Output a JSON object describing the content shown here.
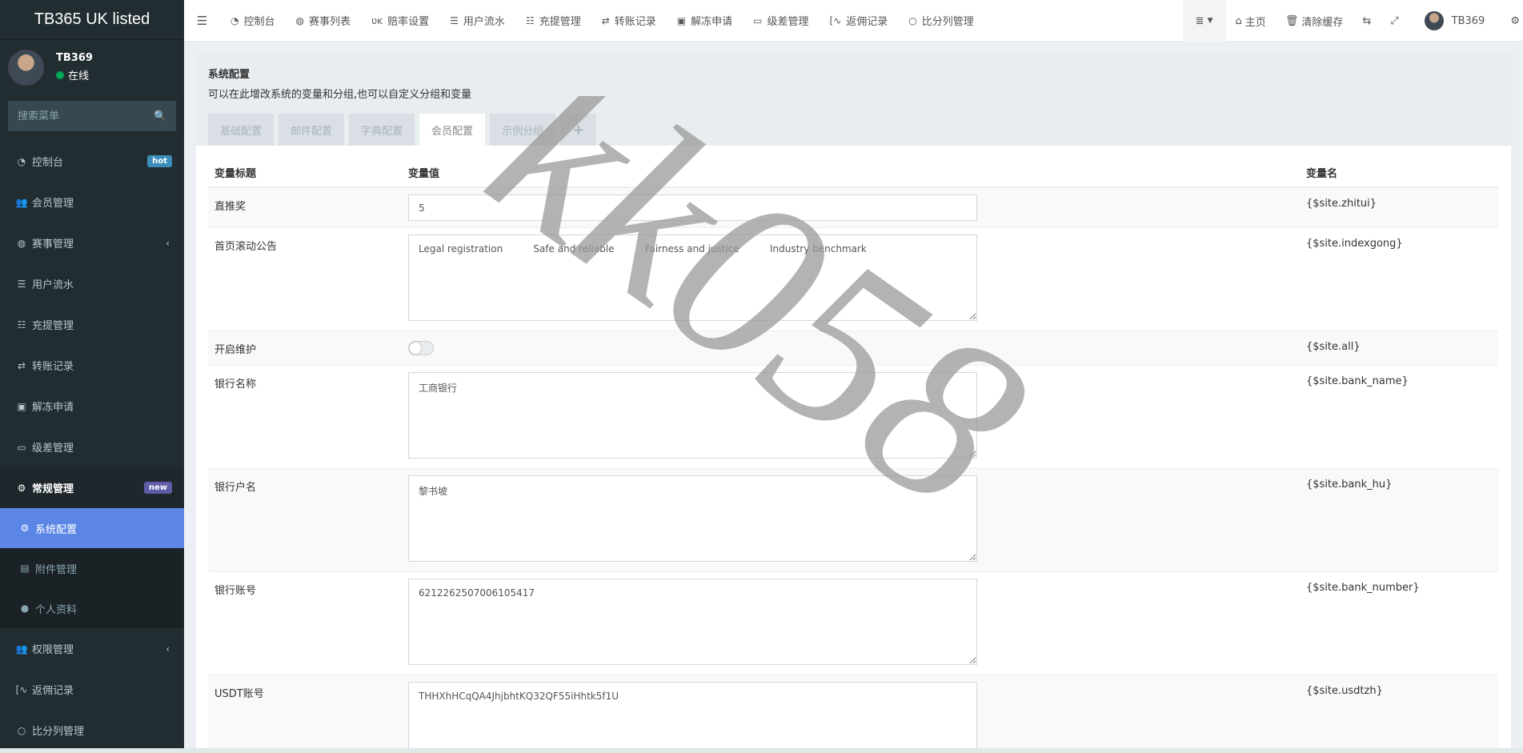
{
  "brand": "TB365 UK listed",
  "user": {
    "name": "TB369",
    "status": "在线"
  },
  "search": {
    "placeholder": "搜索菜单"
  },
  "sidebar": {
    "items": [
      {
        "label": "控制台",
        "badge": "hot",
        "icon": "dashboard-icon"
      },
      {
        "label": "会员管理",
        "icon": "users-icon"
      },
      {
        "label": "赛事管理",
        "icon": "globe-icon"
      },
      {
        "label": "用户流水",
        "icon": "list-icon"
      },
      {
        "label": "充提管理",
        "icon": "list-alt-icon"
      },
      {
        "label": "转账记录",
        "icon": "transfer-icon"
      },
      {
        "label": "解冻申请",
        "icon": "image-icon"
      },
      {
        "label": "级差管理",
        "icon": "window-icon"
      },
      {
        "label": "常规管理",
        "badge": "new",
        "icon": "cogs-icon"
      }
    ],
    "sub_items": [
      {
        "label": "系统配置",
        "icon": "gear-icon"
      },
      {
        "label": "附件管理",
        "icon": "file-image-icon"
      },
      {
        "label": "个人资料",
        "icon": "user-icon"
      }
    ],
    "bottom_items": [
      {
        "label": "权限管理",
        "icon": "users-icon"
      },
      {
        "label": "返佣记录",
        "icon": "bracket-icon"
      },
      {
        "label": "比分列管理",
        "icon": "circle-icon"
      }
    ]
  },
  "topnav": {
    "tabs": [
      "控制台",
      "赛事列表",
      "赔率设置",
      "用户流水",
      "充提管理",
      "转账记录",
      "解冻申请",
      "级差管理",
      "返佣记录",
      "比分列管理"
    ],
    "home": "主页",
    "clear_cache": "清除缓存",
    "username": "TB369"
  },
  "panel": {
    "title": "系统配置",
    "description": "可以在此增改系统的变量和分组,也可以自定义分组和变量",
    "tabs": [
      "基础配置",
      "邮件配置",
      "字典配置",
      "会员配置",
      "示例分组"
    ],
    "active_tab": "会员配置",
    "add_tab": "+"
  },
  "table": {
    "headers": [
      "变量标题",
      "变量值",
      "变量名"
    ],
    "rows": [
      {
        "title": "直推奖",
        "type": "input",
        "value": "5",
        "name": "{$site.zhitui}"
      },
      {
        "title": "首页滚动公告",
        "type": "textarea",
        "value": "Legal registration          Safe and reliable          Fairness and justice          Industry benchmark",
        "name": "{$site.indexgong}"
      },
      {
        "title": "开启维护",
        "type": "switch",
        "value": "off",
        "name": "{$site.all}"
      },
      {
        "title": "银行名称",
        "type": "textarea",
        "value": "工商银行",
        "name": "{$site.bank_name}"
      },
      {
        "title": "银行户名",
        "type": "textarea",
        "value": "黎书坡",
        "name": "{$site.bank_hu}"
      },
      {
        "title": "银行账号",
        "type": "textarea",
        "value": "6212262507006105417",
        "name": "{$site.bank_number}"
      },
      {
        "title": "USDT账号",
        "type": "textarea",
        "value": "THHXhHCqQA4JhjbhtKQ32QF55iHhtk5f1U",
        "name": "{$site.usdtzh}"
      }
    ]
  },
  "watermark": "kk058",
  "colors": {
    "sidebar_bg": "#222d32",
    "active_item": "#5b86e5",
    "hot_badge": "#3c8dbc",
    "new_badge": "#605ca8",
    "online": "#00a65a"
  }
}
